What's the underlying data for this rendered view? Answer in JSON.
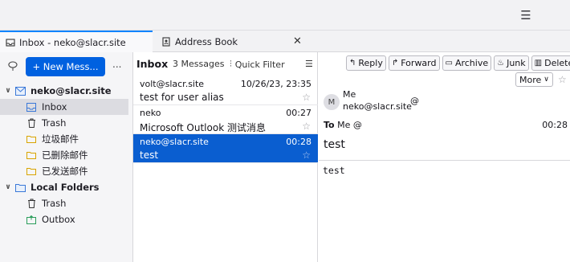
{
  "tabs": [
    {
      "label": "Inbox - neko@slacr.site",
      "active": true
    },
    {
      "label": "Address Book",
      "active": false
    }
  ],
  "folder_pane": {
    "new_message_label": "+ New Mess...",
    "more_label": "...",
    "accounts": [
      {
        "name": "neko@slacr.site",
        "folders": [
          "Inbox",
          "Trash",
          "垃圾邮件",
          "已删除邮件",
          "已发送邮件"
        ]
      },
      {
        "name": "Local Folders",
        "folders": [
          "Trash",
          "Outbox"
        ]
      }
    ],
    "selected_folder": "Inbox"
  },
  "list_pane": {
    "folder_name": "Inbox",
    "count": "3 Messages",
    "quick_filter_label": "Quick Filter",
    "messages": [
      {
        "from": "volt@slacr.site",
        "date": "10/26/23, 23:35",
        "subject": "test for user alias"
      },
      {
        "from": "neko",
        "date": "00:27",
        "subject": "Microsoft Outlook 测试消息"
      },
      {
        "from": "neko@slacr.site",
        "date": "00:28",
        "subject": "test"
      }
    ],
    "selected_index": 2
  },
  "reading_pane": {
    "actions": [
      "Reply",
      "Forward",
      "Archive",
      "Junk",
      "Delete"
    ],
    "more_label": "More",
    "avatar_letter": "M",
    "sender_name": "Me",
    "sender_address": "neko@slacr.site",
    "to_label": "To",
    "to_value": "Me",
    "time": "00:28",
    "subject": "test",
    "body": "test"
  },
  "colors": {
    "accent": "#0a5ed0",
    "button": "#0061e0"
  }
}
